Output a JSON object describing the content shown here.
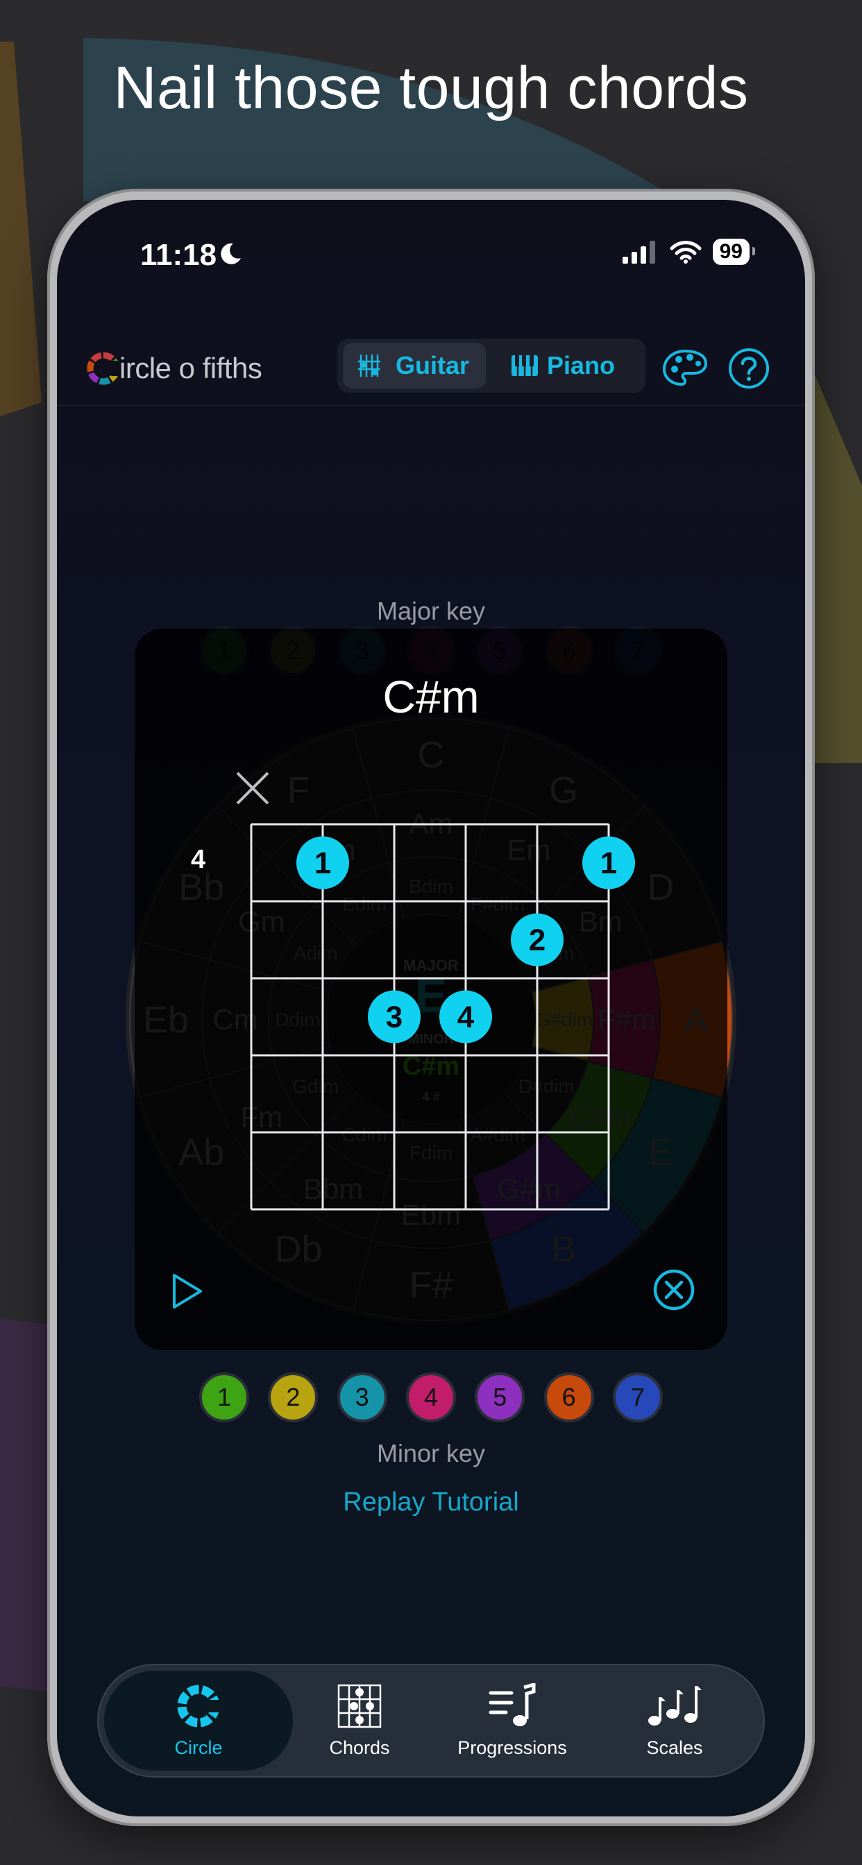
{
  "headline": "Nail those tough chords",
  "status": {
    "time": "11:18",
    "battery": "99"
  },
  "app": {
    "logo_letter": "C",
    "logo_rest": "ircle o fifths"
  },
  "instrument_toggle": {
    "guitar": "Guitar",
    "piano": "Piano",
    "selected": "Guitar"
  },
  "labels": {
    "major_key": "Major key",
    "minor_key": "Minor key",
    "replay": "Replay Tutorial"
  },
  "chord": {
    "name": "C#m",
    "start_fret": "4",
    "dots": [
      {
        "string": 2,
        "fret": 1,
        "finger": "1"
      },
      {
        "string": 6,
        "fret": 1,
        "finger": "1"
      },
      {
        "string": 5,
        "fret": 2,
        "finger": "2"
      },
      {
        "string": 3,
        "fret": 3,
        "finger": "3"
      },
      {
        "string": 4,
        "fret": 3,
        "finger": "4"
      }
    ]
  },
  "major_degrees": [
    "1",
    "2",
    "3",
    "4",
    "5",
    "6",
    "7"
  ],
  "minor_degrees": [
    {
      "label": "1",
      "color": "#3fa414"
    },
    {
      "label": "2",
      "color": "#b8a310"
    },
    {
      "label": "3",
      "color": "#1593a8"
    },
    {
      "label": "4",
      "color": "#c21d6a"
    },
    {
      "label": "5",
      "color": "#8d2fbf"
    },
    {
      "label": "6",
      "color": "#c74a0c"
    },
    {
      "label": "7",
      "color": "#2648b8"
    }
  ],
  "circle": {
    "outer": [
      "C",
      "G",
      "D",
      "A",
      "E",
      "B",
      "F#",
      "Db",
      "Ab",
      "Eb",
      "Bb",
      "F"
    ],
    "middle": [
      "Am",
      "Em",
      "Bm",
      "F#m",
      "C#m",
      "G#m",
      "Ebm",
      "Bbm",
      "Fm",
      "Cm",
      "Gm",
      "Dm"
    ],
    "inner": [
      "Bdim",
      "F#dim",
      "C#dim",
      "G#dim",
      "D#dim",
      "A#dim",
      "Fdim",
      "Cdim",
      "Gdim",
      "Ddim",
      "Adim",
      "Edim"
    ],
    "center_major": "MAJOR",
    "center_key": "E",
    "center_minor_label": "MINOR",
    "center_minor": "C#m",
    "center_sharps": "4 #"
  },
  "tabs": [
    {
      "label": "Circle",
      "active": true
    },
    {
      "label": "Chords",
      "active": false
    },
    {
      "label": "Progressions",
      "active": false
    },
    {
      "label": "Scales",
      "active": false
    }
  ]
}
